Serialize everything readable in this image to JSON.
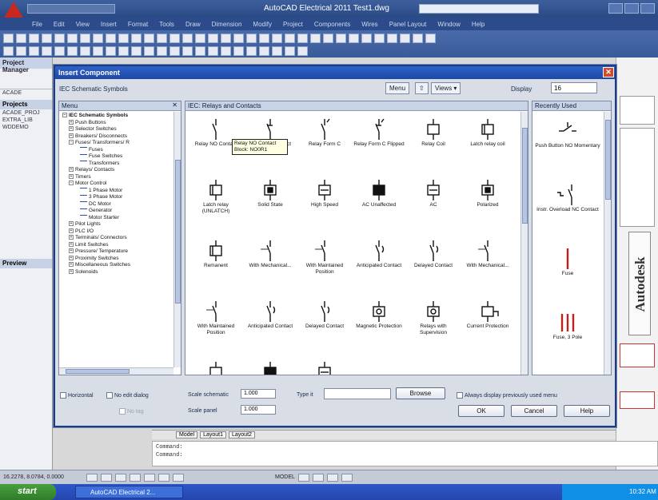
{
  "app": {
    "title": "AutoCAD Electrical 2011 Test1.dwg",
    "search_placeholder": "Type a keyword or phrase",
    "menus": [
      "File",
      "Edit",
      "View",
      "Insert",
      "Format",
      "Tools",
      "Draw",
      "Dimension",
      "Modify",
      "Project",
      "Components",
      "Wires",
      "Panel Layout",
      "Window",
      "Help"
    ],
    "left_panel": {
      "title": "Project Manager",
      "tree_label": "ACADE",
      "projects_label": "Projects",
      "items": [
        "ACADE_PROJ",
        "EXTRA_LIB",
        "WDDEMO"
      ],
      "preview_label": "Preview"
    },
    "right_brand": "Autodesk",
    "layout_tabs": [
      "Model",
      "Layout1",
      "Layout2"
    ],
    "command_lines": [
      "Command:",
      "Command:"
    ],
    "status_coords": "16.2278, 8.0784, 0.0000",
    "status_model": "MODEL",
    "taskbar": {
      "start_label": "start",
      "task_label": "AutoCAD Electrical 2...",
      "clock": "10:32 AM"
    }
  },
  "dialog": {
    "title": "Insert Component",
    "header": "IEC Schematic Symbols",
    "menu_button": "Menu",
    "views_button": "Views",
    "display_label": "Display",
    "display_value": "16",
    "menu_pane_title": "Menu",
    "symbols_pane_title": "IEC: Relays and Contacts",
    "recent_pane_title": "Recently Used",
    "menu_tree": [
      {
        "label": "IEC Schematic Symbols",
        "level": 0,
        "expanded": true
      },
      {
        "label": "Push Buttons",
        "level": 1,
        "expanded": false
      },
      {
        "label": "Selector Switches",
        "level": 1,
        "expanded": false
      },
      {
        "label": "Breakers/ Disconnects",
        "level": 1,
        "expanded": false
      },
      {
        "label": "Fuses/ Transformers/ R",
        "level": 1,
        "expanded": true
      },
      {
        "label": "Fuses",
        "level": 2
      },
      {
        "label": "Fuse Switches",
        "level": 2
      },
      {
        "label": "Transformers",
        "level": 2
      },
      {
        "label": "Relays/ Contacts",
        "level": 1,
        "expanded": false
      },
      {
        "label": "Timers",
        "level": 1,
        "expanded": false
      },
      {
        "label": "Motor Control",
        "level": 1,
        "expanded": true
      },
      {
        "label": "1 Phase Motor",
        "level": 2
      },
      {
        "label": "3 Phase Motor",
        "level": 2
      },
      {
        "label": "DC Motor",
        "level": 2
      },
      {
        "label": "Generator",
        "level": 2
      },
      {
        "label": "Motor Starter",
        "level": 2
      },
      {
        "label": "Pilot Lights",
        "level": 1,
        "expanded": false
      },
      {
        "label": "PLC I/O",
        "level": 1,
        "expanded": false
      },
      {
        "label": "Terminals/ Connectors",
        "level": 1,
        "expanded": false
      },
      {
        "label": "Limit Switches",
        "level": 1,
        "expanded": false
      },
      {
        "label": "Pressure/ Temperature",
        "level": 1,
        "expanded": false
      },
      {
        "label": "Proximity Switches",
        "level": 1,
        "expanded": false
      },
      {
        "label": "Miscellaneous Switches",
        "level": 1,
        "expanded": false
      },
      {
        "label": "Solenoids",
        "level": 1,
        "expanded": false
      }
    ],
    "symbols": [
      {
        "label": "Relay NO Contact",
        "glyph": "contact-no"
      },
      {
        "label": "Relay NC Contact",
        "glyph": "contact-nc"
      },
      {
        "label": "Relay Form C",
        "glyph": "contact-c"
      },
      {
        "label": "Relay Form C Flipped",
        "glyph": "contact-c-flip"
      },
      {
        "label": "Relay Coil",
        "glyph": "coil"
      },
      {
        "label": "Latch relay coil",
        "glyph": "coil-latch"
      },
      {
        "label": "Latch relay (UNLATCH)",
        "glyph": "coil-unlatch"
      },
      {
        "label": "Solid State",
        "glyph": "coil-solid"
      },
      {
        "label": "High Speed",
        "glyph": "coil-hs"
      },
      {
        "label": "AC Unaffected",
        "glyph": "coil-dark"
      },
      {
        "label": "AC",
        "glyph": "coil-ac"
      },
      {
        "label": "Polarized",
        "glyph": "coil-pol"
      },
      {
        "label": "Remanent",
        "glyph": "coil-rem"
      },
      {
        "label": "With Mechanical...",
        "glyph": "contact-mech"
      },
      {
        "label": "With Maintained Position",
        "glyph": "contact-maint"
      },
      {
        "label": "Anticipated Contact",
        "glyph": "contact-ant"
      },
      {
        "label": "Delayed Contact",
        "glyph": "contact-del"
      },
      {
        "label": "With Mechanical...",
        "glyph": "contact-mech2"
      },
      {
        "label": "With Maintained Position",
        "glyph": "contact-maint2"
      },
      {
        "label": "Anticipated Contact",
        "glyph": "contact-ant2"
      },
      {
        "label": "Delayed Contact",
        "glyph": "contact-del2"
      },
      {
        "label": "Magnetic Protection",
        "glyph": "coil-mag"
      },
      {
        "label": "Relays with Supervision",
        "glyph": "coil-sup"
      },
      {
        "label": "Current Protection",
        "glyph": "coil-cur"
      },
      {
        "label": "",
        "glyph": "coil"
      },
      {
        "label": "",
        "glyph": "coil-dark"
      },
      {
        "label": "",
        "glyph": "coil-ac"
      }
    ],
    "tooltip": [
      "Relay NO Contact",
      "Block: NO0R1"
    ],
    "recent": [
      {
        "label": "Push Button NO Momentary",
        "glyph": "pb-no"
      },
      {
        "label": "Instr. Overload NC Contact",
        "glyph": "ol-nc"
      },
      {
        "label": "Fuse",
        "glyph": "fuse"
      },
      {
        "label": "Fuse, 3 Pole",
        "glyph": "fuse3"
      },
      {
        "label": "",
        "glyph": "fuse3-red"
      }
    ],
    "horizontal_label": "Horizontal",
    "no_edit_label": "No edit dialog",
    "no_tag_label": "No tag",
    "scale_schematic_label": "Scale schematic",
    "scale_schematic_value": "1.000",
    "scale_panel_label": "Scale panel",
    "scale_panel_value": "1.000",
    "type_it_label": "Type it",
    "type_it_value": "",
    "browse_label": "Browse",
    "always_display_label": "Always display previously used menu",
    "ok_label": "OK",
    "cancel_label": "Cancel",
    "help_label": "Help"
  }
}
